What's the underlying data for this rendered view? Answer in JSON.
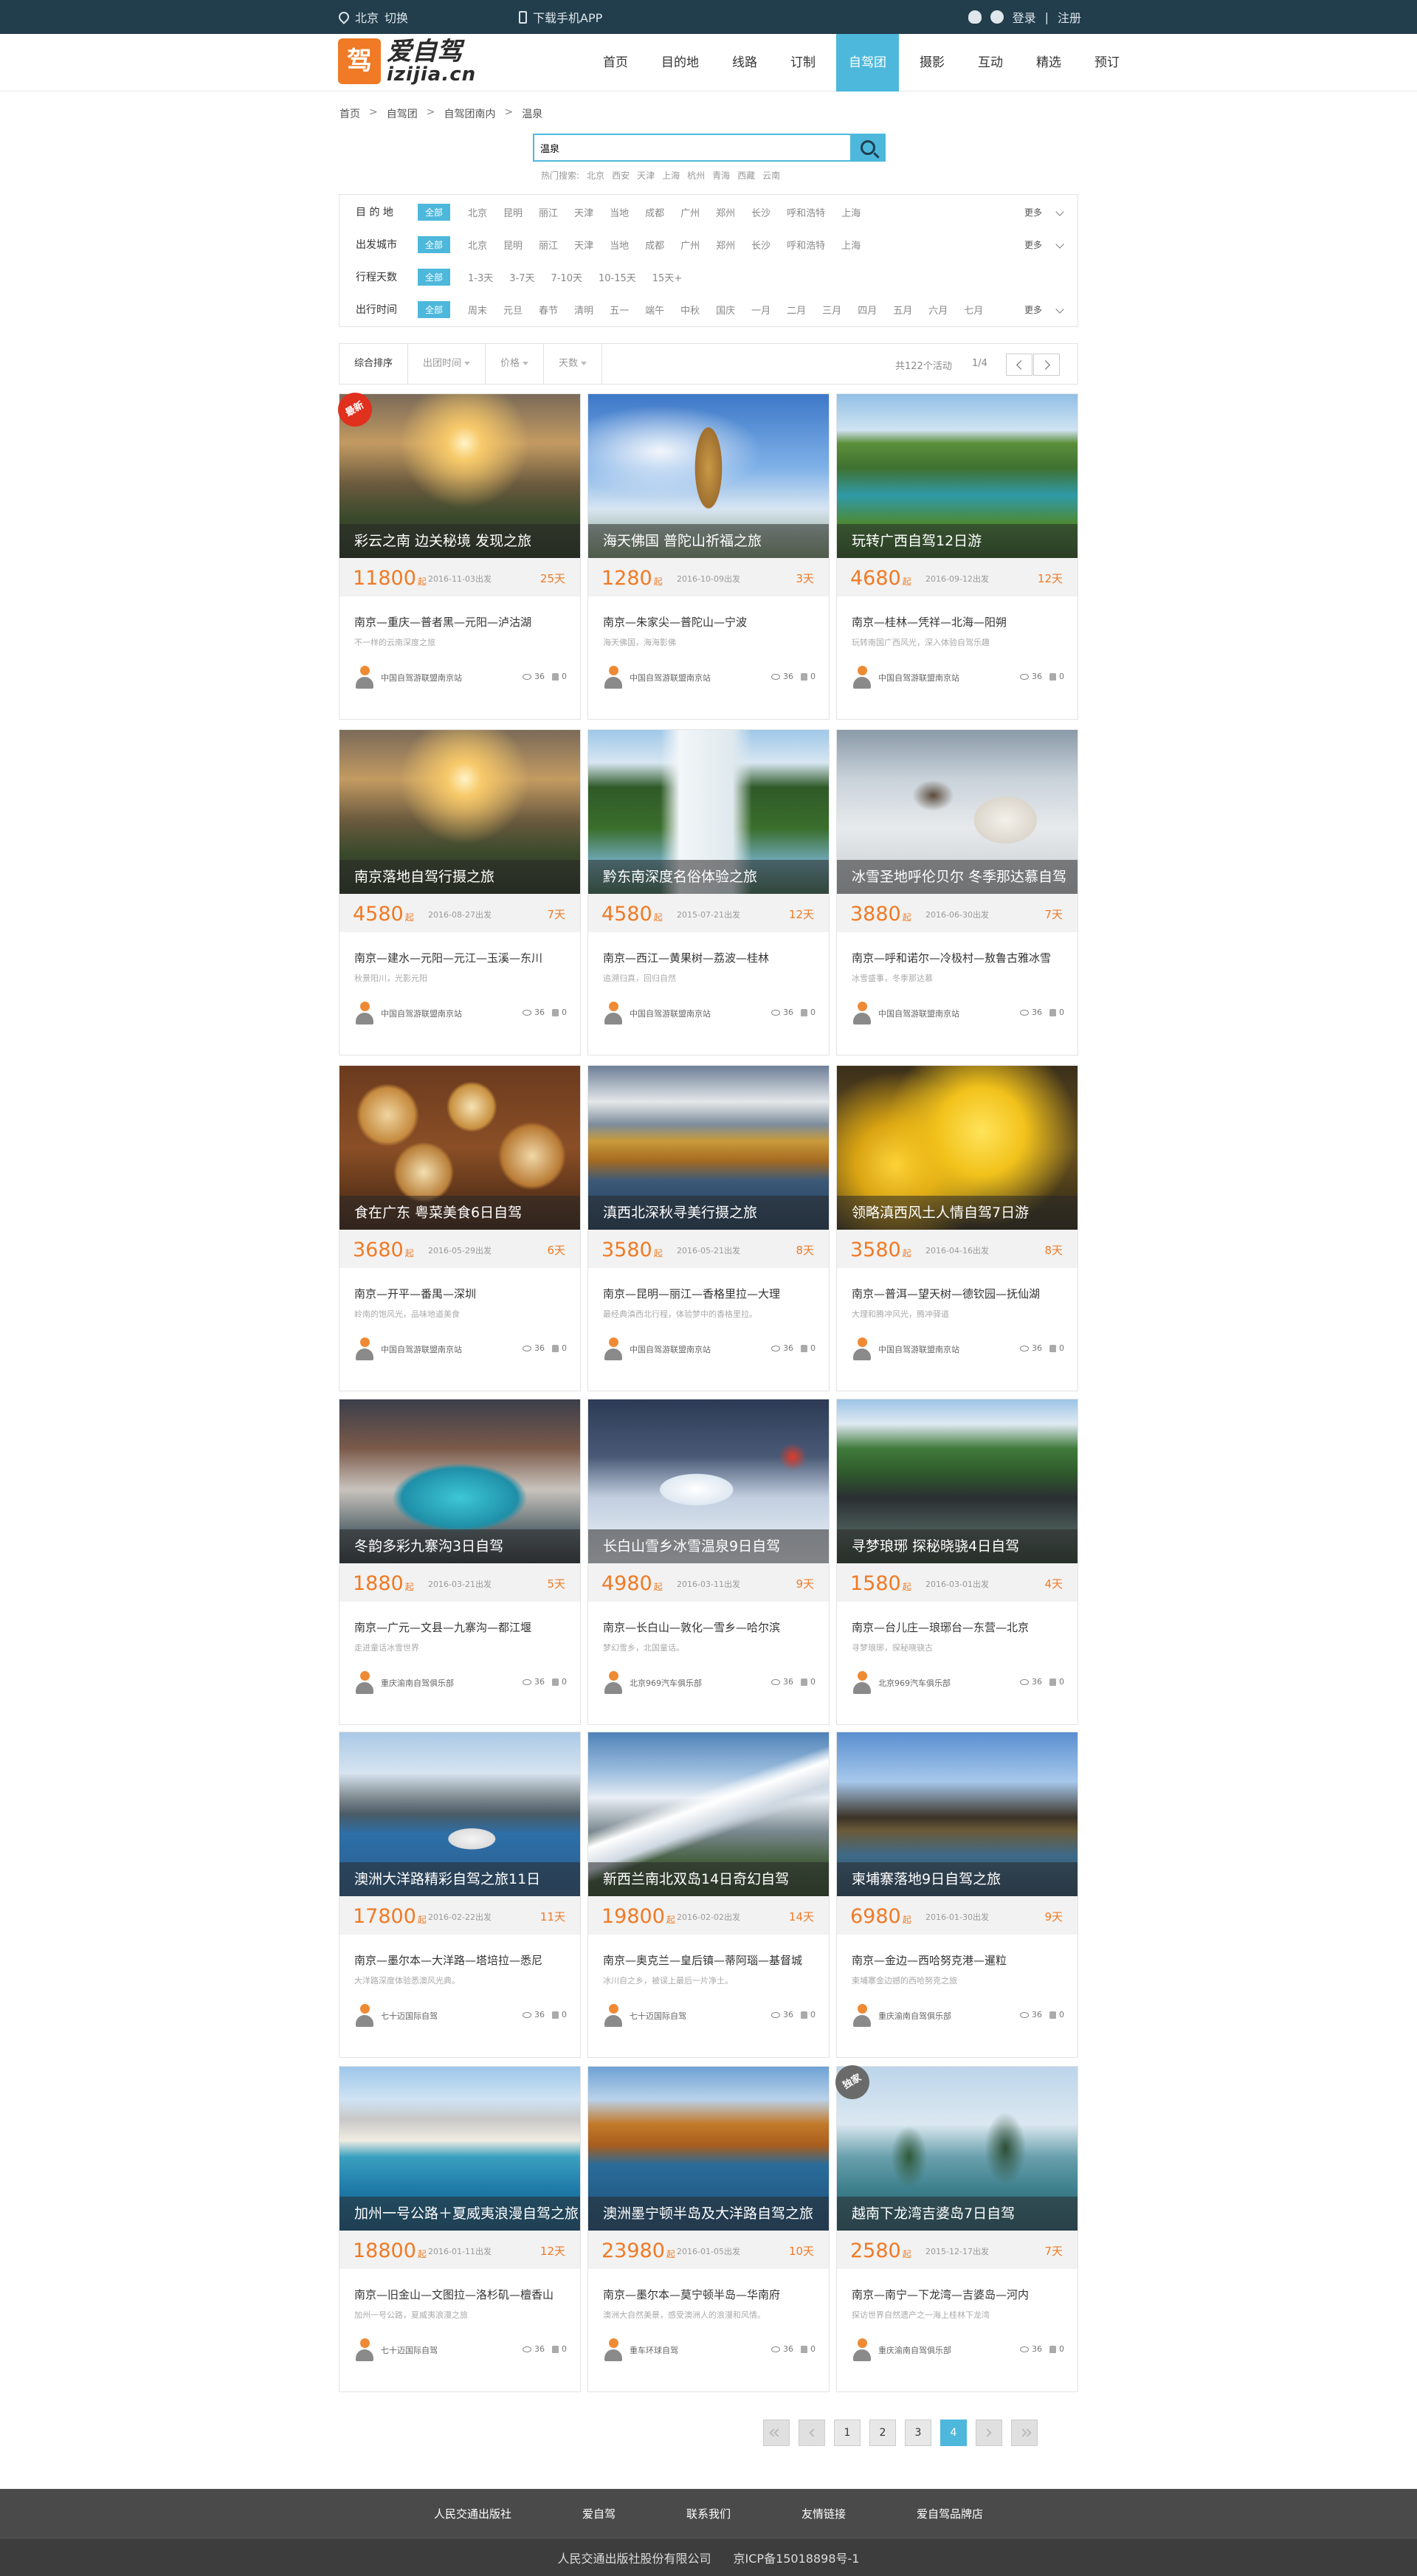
{
  "topbar": {
    "city": "北京",
    "switch": "切换",
    "download_app": "下载手机APP",
    "login": "登录",
    "divider": "|",
    "register": "注册"
  },
  "header": {
    "logo_cn": "爱自驾",
    "logo_en": "izijia.cn",
    "logo_mark": "驾",
    "nav": [
      "首页",
      "目的地",
      "线路",
      "订制",
      "自驾团",
      "摄影",
      "互动",
      "精选",
      "预订"
    ],
    "active_nav": "自驾团"
  },
  "breadcrumb": [
    "首页",
    "自驾团",
    "自驾团南内",
    "温泉"
  ],
  "search": {
    "value": "温泉",
    "hot_label": "热门搜索:",
    "hot": [
      "北京",
      "西安",
      "天津",
      "上海",
      "杭州",
      "青海",
      "西藏",
      "云南"
    ]
  },
  "filters": [
    {
      "label": "目 的 地",
      "all": "全部",
      "options": [
        "北京",
        "昆明",
        "丽江",
        "天津",
        "当地",
        "成都",
        "广州",
        "郑州",
        "长沙",
        "呼和浩特",
        "上海"
      ],
      "more": "更多"
    },
    {
      "label": "出发城市",
      "all": "全部",
      "options": [
        "北京",
        "昆明",
        "丽江",
        "天津",
        "当地",
        "成都",
        "广州",
        "郑州",
        "长沙",
        "呼和浩特",
        "上海"
      ],
      "more": "更多"
    },
    {
      "label": "行程天数",
      "all": "全部",
      "options": [
        "1-3天",
        "3-7天",
        "7-10天",
        "10-15天",
        "15天+"
      ],
      "more": ""
    },
    {
      "label": "出行时间",
      "all": "全部",
      "options": [
        "周末",
        "元旦",
        "春节",
        "清明",
        "五一",
        "端午",
        "中秋",
        "国庆",
        "一月",
        "二月",
        "三月",
        "四月",
        "五月",
        "六月",
        "七月"
      ],
      "more": "更多"
    }
  ],
  "sortbar": {
    "items": [
      "综合排序",
      "出团时间",
      "价格",
      "天数"
    ],
    "total": "共122个活动",
    "page": "1/4"
  },
  "price_unit": "起",
  "cards": [
    {
      "title": "彩云之南 边关秘境 发现之旅",
      "price": "11800",
      "date": "2016-11-03出发",
      "days": "25天",
      "route": "南京—重庆—普者黑—元阳—泸沽湖",
      "desc": "不一样的云南深度之旅",
      "club": "中国自驾游联盟南京站",
      "views": "36",
      "likes": "0",
      "badge": "最新",
      "scene": "mountain"
    },
    {
      "title": "海天佛国 普陀山祈福之旅",
      "price": "1280",
      "date": "2016-10-09出发",
      "days": "3天",
      "route": "南京—朱家尖—普陀山—宁波",
      "desc": "海天佛国，海海影佛",
      "club": "中国自驾游联盟南京站",
      "views": "36",
      "likes": "0",
      "badge": "",
      "scene": "statue"
    },
    {
      "title": "玩转广西自驾12日游",
      "price": "4680",
      "date": "2016-09-12出发",
      "days": "12天",
      "route": "南京—桂林—凭祥—北海—阳朔",
      "desc": "玩转南国广西风光，深入体验自驾乐趣",
      "club": "中国自驾游联盟南京站",
      "views": "36",
      "likes": "0",
      "badge": "",
      "scene": "river"
    },
    {
      "title": "南京落地自驾行摄之旅",
      "price": "4580",
      "date": "2016-08-27出发",
      "days": "7天",
      "route": "南京—建水—元阳—元江—玉溪—东川",
      "desc": "秋景阳川，光影元阳",
      "club": "中国自驾游联盟南京站",
      "views": "36",
      "likes": "0",
      "badge": "",
      "scene": "mountain"
    },
    {
      "title": "黔东南深度名俗体验之旅",
      "price": "4580",
      "date": "2015-07-21出发",
      "days": "12天",
      "route": "南京—西江—黄果树—荔波—桂林",
      "desc": "追溯归真，回归自然",
      "club": "中国自驾游联盟南京站",
      "views": "36",
      "likes": "0",
      "badge": "",
      "scene": "waterfall"
    },
    {
      "title": "冰雪圣地呼伦贝尔 冬季那达慕自驾",
      "price": "3880",
      "date": "2016-06-30出发",
      "days": "7天",
      "route": "南京—呼和诺尔—冷极村—敖鲁古雅冰雪",
      "desc": "冰雪盛事，冬季那达慕",
      "club": "中国自驾游联盟南京站",
      "views": "36",
      "likes": "0",
      "badge": "",
      "scene": "snowhorse"
    },
    {
      "title": "食在广东 粤菜美食6日自驾",
      "price": "3680",
      "date": "2016-05-29出发",
      "days": "6天",
      "route": "南京—开平—番禺—深圳",
      "desc": "岭南的饱风光，品味地道美食",
      "club": "中国自驾游联盟南京站",
      "views": "36",
      "likes": "0",
      "badge": "",
      "scene": "food"
    },
    {
      "title": "滇西北深秋寻美行摄之旅",
      "price": "3580",
      "date": "2016-05-21出发",
      "days": "8天",
      "route": "南京—昆明—丽江—香格里拉—大理",
      "desc": "最经典滇西北行程，体验梦中的香格里拉。",
      "club": "中国自驾游联盟南京站",
      "views": "36",
      "likes": "0",
      "badge": "",
      "scene": "autumnlake"
    },
    {
      "title": "领略滇西风土人情自驾7日游",
      "price": "3580",
      "date": "2016-04-16出发",
      "days": "8天",
      "route": "南京—普洱—望天树—德钦园—抚仙湖",
      "desc": "大理和腾冲风光，腾冲驿道",
      "club": "中国自驾游联盟南京站",
      "views": "36",
      "likes": "0",
      "badge": "",
      "scene": "ginkgo"
    },
    {
      "title": "冬韵多彩九寨沟3日自驾",
      "price": "1880",
      "date": "2016-03-21出发",
      "days": "5天",
      "route": "南京—广元—文县—九寨沟—都江堰",
      "desc": "走进童话冰雪世界",
      "club": "重庆渝南自驾俱乐部",
      "views": "36",
      "likes": "0",
      "badge": "",
      "scene": "icelake"
    },
    {
      "title": "长白山雪乡冰雪温泉9日自驾",
      "price": "4980",
      "date": "2016-03-11出发",
      "days": "9天",
      "route": "南京—长白山—敦化—雪乡—哈尔滨",
      "desc": "梦幻雪乡，北国童话。",
      "club": "北京969汽车俱乐部",
      "views": "36",
      "likes": "0",
      "badge": "",
      "scene": "snowvillage"
    },
    {
      "title": "寻梦琅琊 探秘晓骁4日自驾",
      "price": "1580",
      "date": "2016-03-01出发",
      "days": "4天",
      "route": "南京—台儿庄—琅琊台—东营—北京",
      "desc": "寻梦琅琊，探秘晓骁古",
      "club": "北京969汽车俱乐部",
      "views": "36",
      "likes": "0",
      "badge": "",
      "scene": "temple"
    },
    {
      "title": "澳洲大洋路精彩自驾之旅11日",
      "price": "17800",
      "date": "2016-02-22出发",
      "days": "11天",
      "route": "南京—墨尔本—大洋路—塔培拉—悉尼",
      "desc": "大洋路深度体验悉澳风光典。",
      "club": "七十迈国际自驾",
      "views": "36",
      "likes": "0",
      "badge": "",
      "scene": "sydney"
    },
    {
      "title": "新西兰南北双岛14日奇幻自驾",
      "price": "19800",
      "date": "2016-02-02出发",
      "days": "14天",
      "route": "南京—奥克兰—皇后镇—蒂阿瑙—基督城",
      "desc": "冰川自之乡，被误上最后一片净土。",
      "club": "七十迈国际自驾",
      "views": "36",
      "likes": "0",
      "badge": "",
      "scene": "alps"
    },
    {
      "title": "柬埔寨落地9日自驾之旅",
      "price": "6980",
      "date": "2016-01-30出发",
      "days": "9天",
      "route": "南京—金边—西哈努克港—暹粒",
      "desc": "柬埔寨金边撼的西哈努克之旅",
      "club": "重庆渝南自驾俱乐部",
      "views": "36",
      "likes": "0",
      "badge": "",
      "scene": "angkor"
    },
    {
      "title": "加州一号公路＋夏威夷浪漫自驾之旅",
      "price": "18800",
      "date": "2016-01-11出发",
      "days": "12天",
      "route": "南京—旧金山—文图拉—洛杉矶—檀香山",
      "desc": "加州一号公路，夏威夷浪漫之旅",
      "club": "七十迈国际自驾",
      "views": "36",
      "likes": "0",
      "badge": "",
      "scene": "hawaii"
    },
    {
      "title": "澳洲墨宁顿半岛及大洋路自驾之旅",
      "price": "23980",
      "date": "2016-01-05出发",
      "days": "10天",
      "route": "南京—墨尔本—莫宁顿半岛—华南府",
      "desc": "澳洲大自然美景，感受澳洲人的浪漫和风情。",
      "club": "重车环球自驾",
      "views": "36",
      "likes": "0",
      "badge": "",
      "scene": "coast"
    },
    {
      "title": "越南下龙湾吉婆岛7日自驾",
      "price": "2580",
      "date": "2015-12-17出发",
      "days": "7天",
      "route": "南京—南宁—下龙湾—吉婆岛—河内",
      "desc": "探访世界自然遗产之一海上桂林下龙湾",
      "club": "重庆渝南自驾俱乐部",
      "views": "36",
      "likes": "0",
      "badge": "独家",
      "scene": "halong"
    }
  ],
  "pagination": [
    "1",
    "2",
    "3",
    "4"
  ],
  "pagination_active": "4",
  "footer": {
    "links": [
      "人民交通出版社",
      "爱自驾",
      "联系我们",
      "友情链接",
      "爱自驾品牌店"
    ],
    "company": "人民交通出版社股份有限公司",
    "icp": "京ICP备15018898号-1"
  },
  "colors": {
    "topbar": "#223d4c",
    "accent": "#4db8dc",
    "price": "#f07a25",
    "badge_new": "#e0301e",
    "badge_exclusive": "#6a6a6a",
    "footer": "#4a4a4a"
  },
  "icons": {
    "location": "map-pin-icon",
    "app": "phone-icon",
    "qq": "qq-icon",
    "weibo": "weibo-icon",
    "search": "search-icon",
    "views": "eye-icon",
    "likes": "thumb-up-icon"
  }
}
